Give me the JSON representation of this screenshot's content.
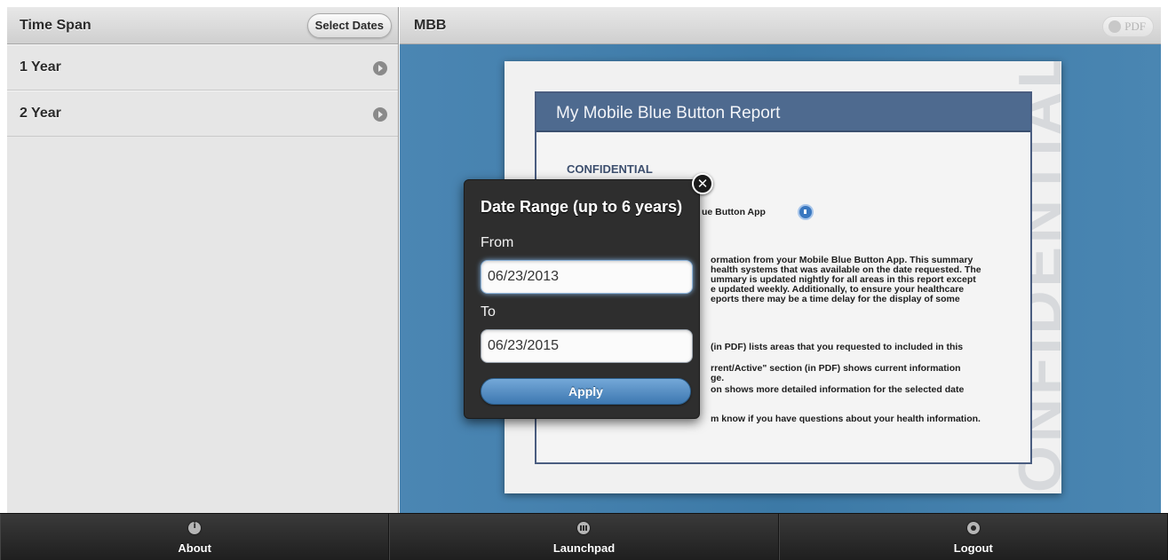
{
  "left_panel": {
    "title": "Time Span",
    "select_dates_label": "Select Dates",
    "items": [
      {
        "label": "1 Year"
      },
      {
        "label": "2 Year"
      }
    ]
  },
  "right_panel": {
    "title": "MBB",
    "pdf_label": "PDF"
  },
  "document": {
    "report_title": "My Mobile Blue Button Report",
    "confidential_label": "CONFIDENTIAL",
    "watermark": "CONFIDENTIAL",
    "lines": {
      "app_line": "ue Button App",
      "p1": "ormation from your Mobile Blue Button App. This summary",
      "p2": "health systems that was available on the date requested. The",
      "p3": "ummary is updated nightly for all areas in this report except",
      "p4": "e updated weekly. Additionally, to ensure your healthcare",
      "p5": "eports there may be a time delay for the display of some",
      "p6": "(in PDF) lists areas that you requested to included in this",
      "p7": "rrent/Active\" section (in PDF) shows current information",
      "p8": "ge.",
      "p9": "on shows more detailed information for the selected date",
      "p10": "m know if you have questions about your health information."
    }
  },
  "popup": {
    "title": "Date Range (up to 6 years)",
    "from_label": "From",
    "from_value": "06/23/2013",
    "to_label": "To",
    "to_value": "06/23/2015",
    "apply_label": "Apply",
    "close_glyph": "✕"
  },
  "footer": {
    "tabs": [
      {
        "label": "About",
        "icon": "info-icon"
      },
      {
        "label": "Launchpad",
        "icon": "grid-icon"
      },
      {
        "label": "Logout",
        "icon": "gear-icon"
      }
    ]
  },
  "colors": {
    "accent_blue": "#3f7aa6",
    "report_header": "#4e6a8f",
    "apply_button": "#4f8ac0",
    "footer_bg": "#2a2a2a"
  }
}
